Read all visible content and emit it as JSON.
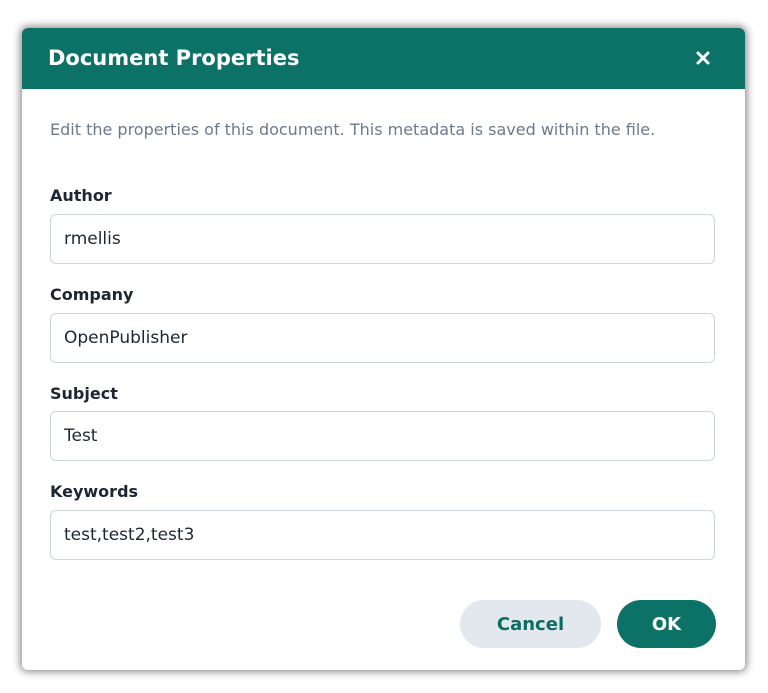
{
  "dialog": {
    "title": "Document Properties",
    "close_icon": "close-icon",
    "description": "Edit the properties of this document. This metadata is saved within the file."
  },
  "fields": {
    "author": {
      "label": "Author",
      "value": "rmellis"
    },
    "company": {
      "label": "Company",
      "value": "OpenPublisher"
    },
    "subject": {
      "label": "Subject",
      "value": "Test"
    },
    "keywords": {
      "label": "Keywords",
      "value": "test,test2,test3"
    }
  },
  "buttons": {
    "cancel_label": "Cancel",
    "ok_label": "OK"
  },
  "colors": {
    "header": "#0c7167",
    "primary_button": "#0c7167",
    "secondary_button": "#e2e8ed",
    "description_text": "#6e7a8a"
  }
}
